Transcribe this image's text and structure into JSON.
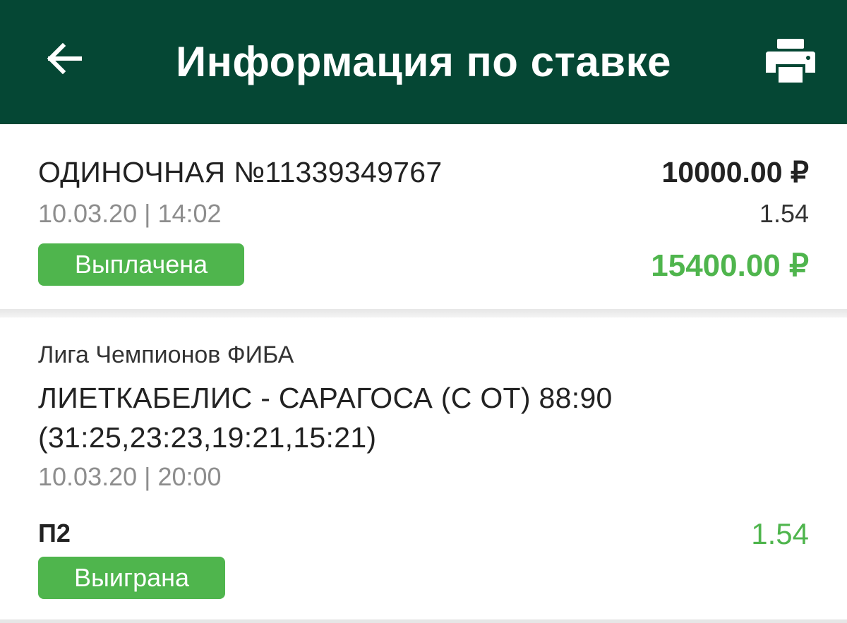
{
  "header": {
    "title": "Информация по ставке",
    "back_icon": "arrow-left-icon",
    "print_icon": "printer-icon",
    "background_color": "#054734"
  },
  "bet": {
    "type_number": "ОДИНОЧНАЯ №11339349767",
    "datetime": "10.03.20 | 14:02",
    "status": "Выплачена",
    "stake": "10000.00 ₽",
    "coefficient": "1.54",
    "payout": "15400.00 ₽"
  },
  "event": {
    "league": "Лига Чемпионов ФИБА",
    "match": "ЛИЕТКАБЕЛИС - САРАГОСА (С ОТ) 88:90 (31:25,23:23,19:21,15:21)",
    "datetime": "10.03.20 | 20:00",
    "outcome": "П2",
    "coefficient": "1.54",
    "status": "Выиграна"
  },
  "colors": {
    "accent_green": "#4fb54d",
    "header_green": "#054734"
  }
}
